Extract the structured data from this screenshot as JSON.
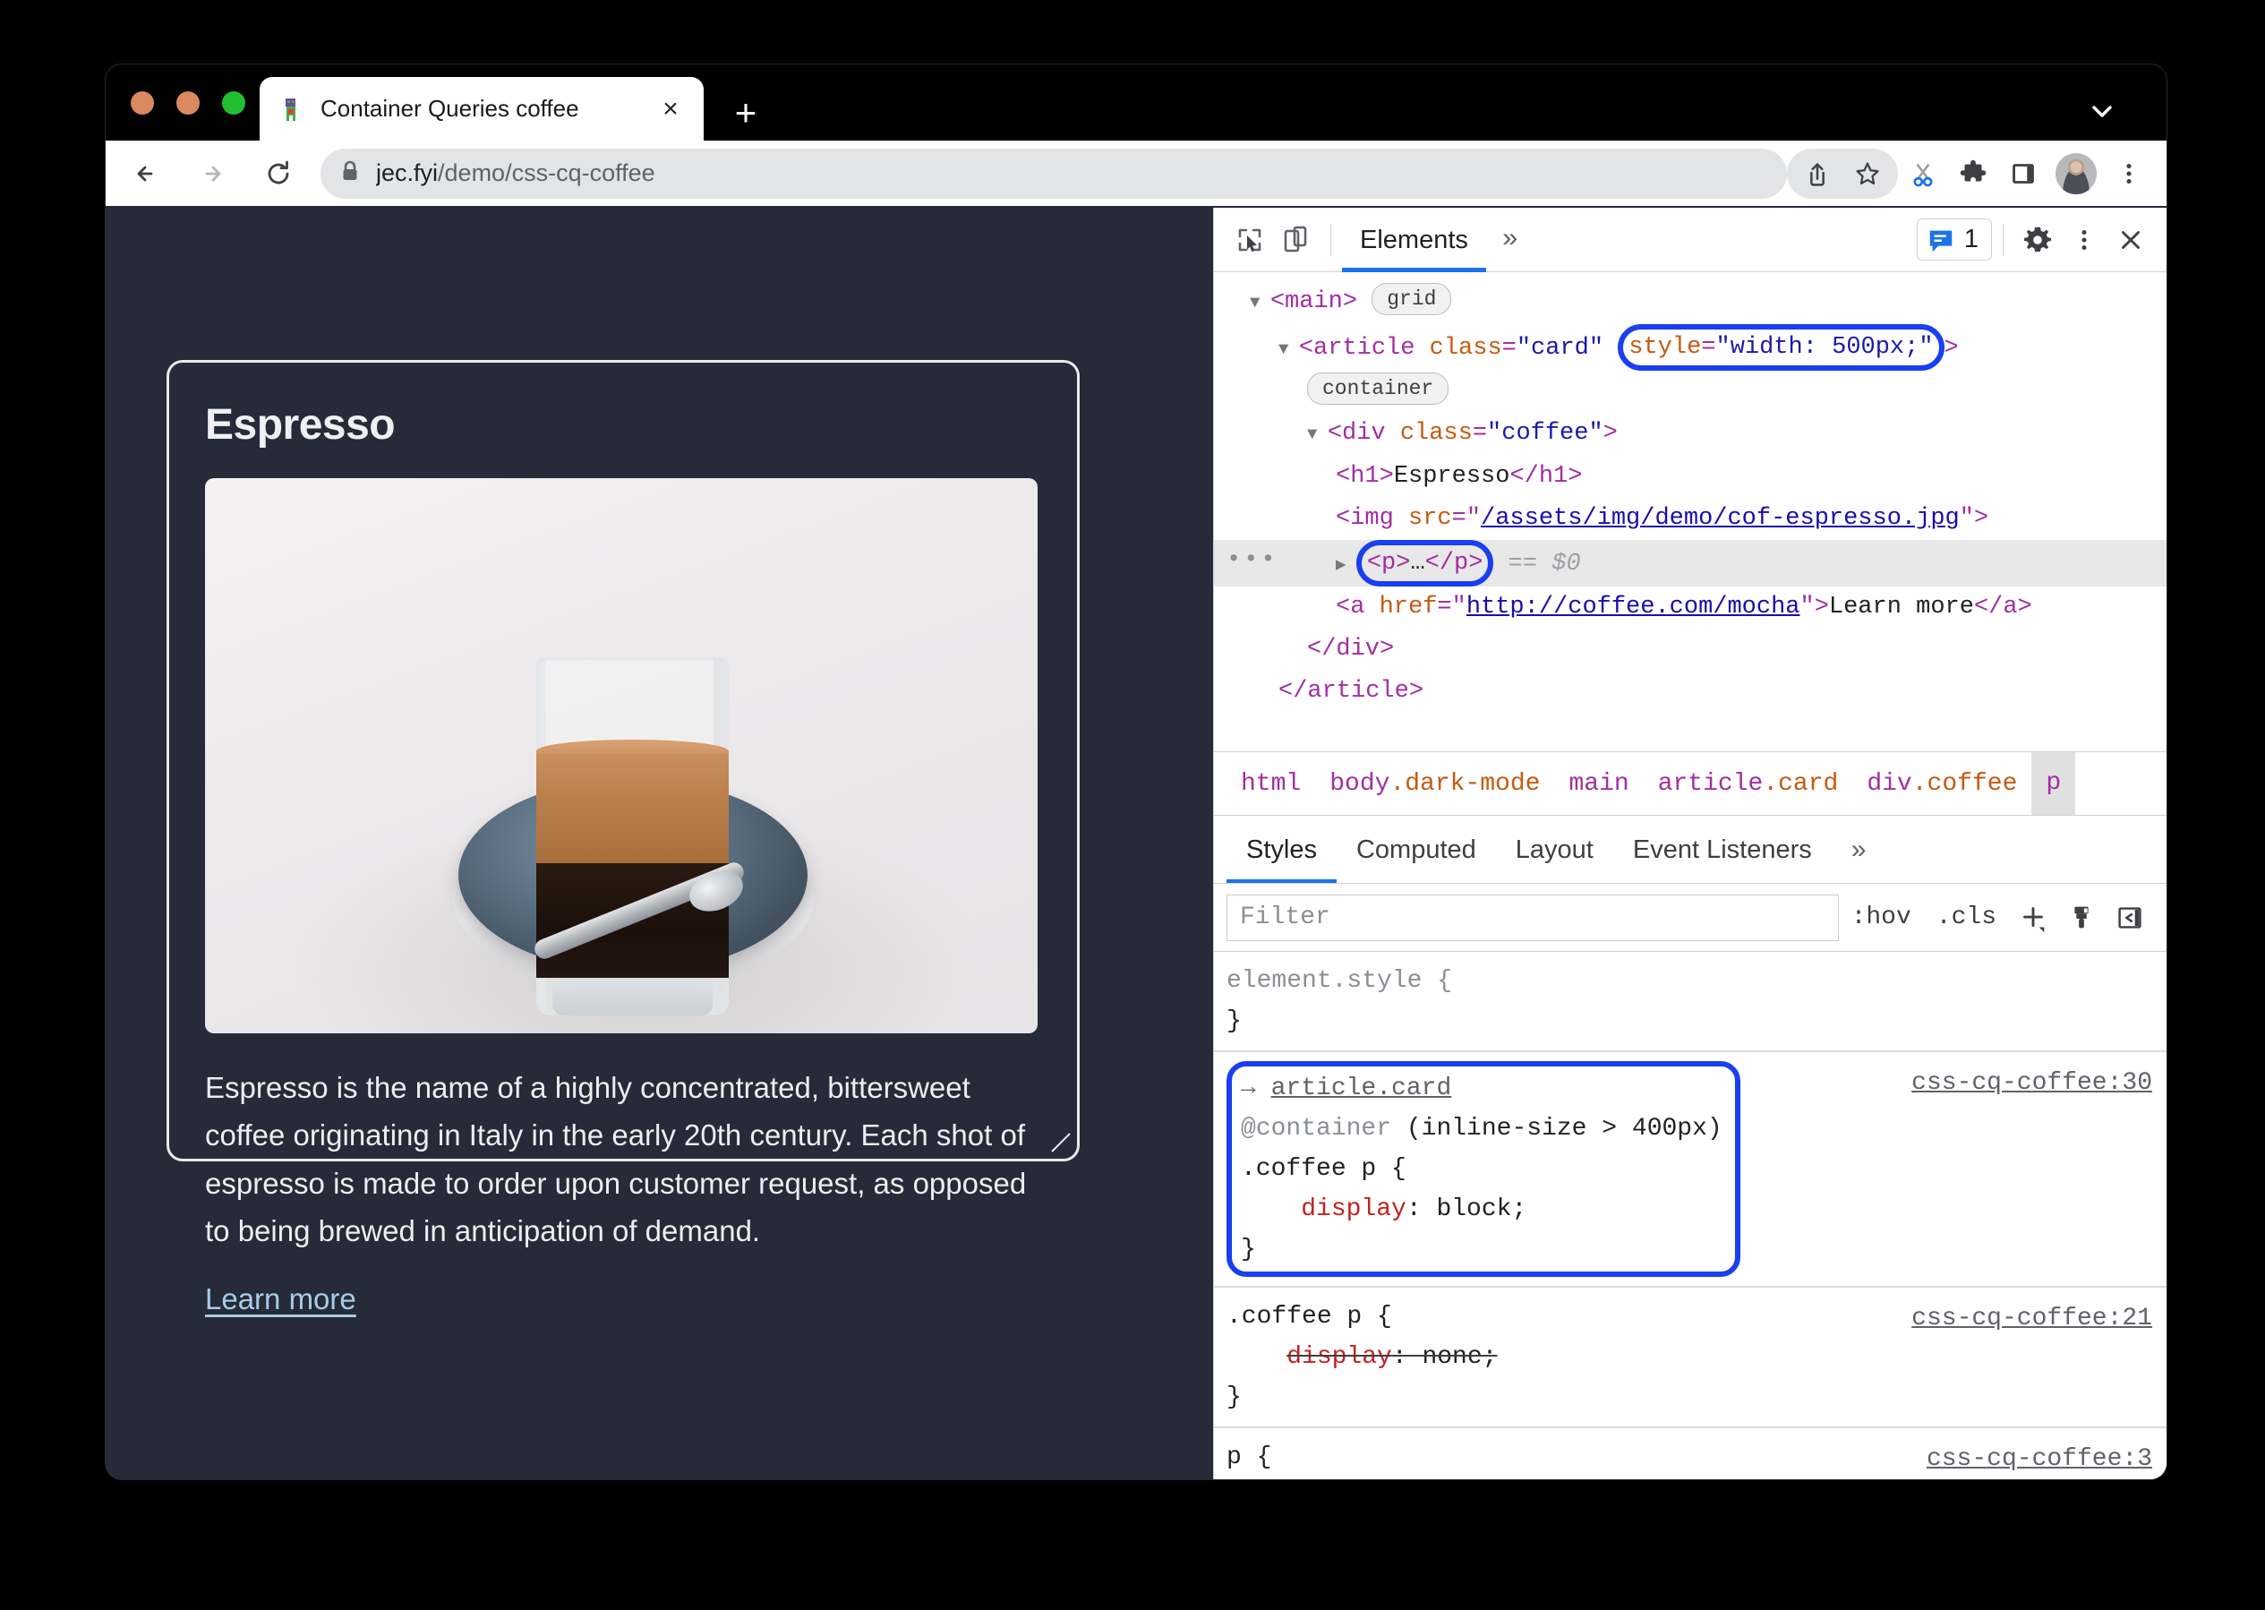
{
  "browser": {
    "tab": {
      "title": "Container Queries coffee",
      "favicon": "chrome-dino-favicon",
      "close": "×"
    },
    "new_tab_label": "+",
    "omnibox": {
      "url_host": "jec.fyi",
      "url_path": "/demo/css-cq-coffee",
      "lock": "lock-icon"
    },
    "toolbar_icons": [
      "share-icon",
      "bookmark-star-icon",
      "scissors-icon",
      "extensions-puzzle-icon",
      "side-panel-icon",
      "profile-avatar",
      "chrome-menu-icon"
    ],
    "nav": {
      "back": "back-arrow",
      "forward": "forward-arrow",
      "reload": "reload-icon"
    }
  },
  "page": {
    "card": {
      "title": "Espresso",
      "image_alt": "espresso glass on blue saucer with spoon",
      "paragraph": "Espresso is the name of a highly concentrated, bittersweet coffee originating in Italy in the early 20th century. Each shot of espresso is made to order upon customer request, as opposed to being brewed in anticipation of demand.",
      "link_label": "Learn more"
    },
    "colors": {
      "background": "#252b38",
      "card_border": "#e9eaec",
      "text": "#eceef1",
      "link": "#a8cbe8"
    }
  },
  "devtools": {
    "toolbar": {
      "inspect_icon": "inspect-cursor-icon",
      "device_icon": "device-toolbar-icon",
      "active_tab": "Elements",
      "more_tabs": "»",
      "issues_count": "1",
      "settings_icon": "gear-icon",
      "menu_icon": "vertical-dots-icon",
      "close_icon": "close-icon"
    },
    "tree": [
      {
        "indent": 1,
        "triangle": "▼",
        "parts": [
          {
            "t": "tag",
            "s": "<main>"
          },
          {
            "t": "space",
            "s": " "
          },
          {
            "t": "badge",
            "s": "grid"
          }
        ]
      },
      {
        "indent": 2,
        "triangle": "▼",
        "parts": [
          {
            "t": "tag",
            "s": "<article "
          },
          {
            "t": "attr",
            "s": "class"
          },
          {
            "t": "tag",
            "s": "="
          },
          {
            "t": "val",
            "s": "\"card\""
          },
          {
            "t": "space",
            "s": " "
          },
          {
            "t": "hl-start",
            "s": ""
          },
          {
            "t": "attr",
            "s": "style"
          },
          {
            "t": "tag",
            "s": "="
          },
          {
            "t": "val",
            "s": "\"width: 500px;\""
          },
          {
            "t": "hl-end",
            "s": ""
          },
          {
            "t": "tag",
            "s": ">"
          }
        ]
      },
      {
        "indent": 3,
        "triangle": "",
        "parts": [
          {
            "t": "badge",
            "s": "container"
          }
        ]
      },
      {
        "indent": 3,
        "triangle": "▼",
        "parts": [
          {
            "t": "tag",
            "s": "<div "
          },
          {
            "t": "attr",
            "s": "class"
          },
          {
            "t": "tag",
            "s": "="
          },
          {
            "t": "val",
            "s": "\"coffee\""
          },
          {
            "t": "tag",
            "s": ">"
          }
        ]
      },
      {
        "indent": 4,
        "triangle": "",
        "parts": [
          {
            "t": "tag",
            "s": "<h1>"
          },
          {
            "t": "txt",
            "s": "Espresso"
          },
          {
            "t": "tag",
            "s": "</h1>"
          }
        ]
      },
      {
        "indent": 4,
        "triangle": "",
        "parts": [
          {
            "t": "tag",
            "s": "<img "
          },
          {
            "t": "attr",
            "s": "src"
          },
          {
            "t": "tag",
            "s": "="
          },
          {
            "t": "tag",
            "s": "\""
          },
          {
            "t": "link",
            "s": "/assets/img/demo/cof-espresso.jpg"
          },
          {
            "t": "tag",
            "s": "\">"
          }
        ]
      },
      {
        "indent": 4,
        "triangle": "▶",
        "selected": true,
        "parts": [
          {
            "t": "hl-start",
            "s": ""
          },
          {
            "t": "tag",
            "s": "<p>"
          },
          {
            "t": "txt",
            "s": "…"
          },
          {
            "t": "tag",
            "s": "</p>"
          },
          {
            "t": "hl-end",
            "s": ""
          },
          {
            "t": "space",
            "s": " "
          },
          {
            "t": "dollar",
            "s": "== $0"
          }
        ]
      },
      {
        "indent": 4,
        "triangle": "",
        "parts": [
          {
            "t": "tag",
            "s": "<a "
          },
          {
            "t": "attr",
            "s": "href"
          },
          {
            "t": "tag",
            "s": "="
          },
          {
            "t": "tag",
            "s": "\""
          },
          {
            "t": "link",
            "s": "http://coffee.com/mocha"
          },
          {
            "t": "tag",
            "s": "\">"
          },
          {
            "t": "txt",
            "s": "Learn more"
          },
          {
            "t": "tag",
            "s": "</a>"
          }
        ]
      },
      {
        "indent": 3,
        "triangle": "",
        "parts": [
          {
            "t": "tag",
            "s": "</div>"
          }
        ]
      },
      {
        "indent": 2,
        "triangle": "",
        "parts": [
          {
            "t": "tag",
            "s": "</article>"
          }
        ]
      }
    ],
    "breadcrumb": [
      {
        "tag": "html",
        "cls": ""
      },
      {
        "tag": "body",
        "cls": ".dark-mode"
      },
      {
        "tag": "main",
        "cls": ""
      },
      {
        "tag": "article",
        "cls": ".card"
      },
      {
        "tag": "div",
        "cls": ".coffee"
      },
      {
        "tag": "p",
        "cls": "",
        "active": true
      }
    ],
    "style_tabs": [
      "Styles",
      "Computed",
      "Layout",
      "Event Listeners"
    ],
    "style_tabs_more": "»",
    "filter": {
      "placeholder": "Filter",
      "value": "",
      "hov_label": ":hov",
      "cls_label": ".cls",
      "new_rule_icon": "plus-icon",
      "print_icon": "paintbrush-icon",
      "sidebar_icon": "computed-sidebar-icon"
    },
    "rules": [
      {
        "id": "element-style",
        "lines": [
          {
            "parts": [
              {
                "t": "grey",
                "s": "element.style {"
              }
            ]
          },
          {
            "parts": [
              {
                "t": "plain",
                "s": "}"
              }
            ]
          }
        ],
        "source": "",
        "highlight": false
      },
      {
        "id": "container-rule",
        "lines": [
          {
            "parts": [
              {
                "t": "arrow",
                "s": "→ "
              },
              {
                "t": "inherit",
                "s": "article.card"
              }
            ]
          },
          {
            "parts": [
              {
                "t": "grey",
                "s": "@container "
              },
              {
                "t": "plain",
                "s": "(inline-size > 400px)"
              }
            ]
          },
          {
            "parts": [
              {
                "t": "plain",
                "s": ".coffee p {"
              }
            ]
          },
          {
            "parts": [
              {
                "t": "plain",
                "s": "    "
              },
              {
                "t": "prop",
                "s": "display"
              },
              {
                "t": "plain",
                "s": ": block;"
              }
            ]
          },
          {
            "parts": [
              {
                "t": "plain",
                "s": "}"
              }
            ]
          }
        ],
        "source": "css-cq-coffee:30",
        "highlight": true
      },
      {
        "id": "coffee-p-rule",
        "lines": [
          {
            "parts": [
              {
                "t": "plain",
                "s": ".coffee p {"
              }
            ]
          },
          {
            "parts": [
              {
                "t": "plain",
                "s": "    "
              },
              {
                "t": "struck-prop",
                "s": "display"
              },
              {
                "t": "struck-plain",
                "s": ": none;"
              }
            ]
          },
          {
            "parts": [
              {
                "t": "plain",
                "s": "}"
              }
            ]
          }
        ],
        "source": "css-cq-coffee:21",
        "highlight": false
      },
      {
        "id": "p-rule",
        "lines": [
          {
            "parts": [
              {
                "t": "plain",
                "s": "p {"
              }
            ]
          }
        ],
        "source": "css-cq-coffee:3",
        "highlight": false
      }
    ]
  }
}
